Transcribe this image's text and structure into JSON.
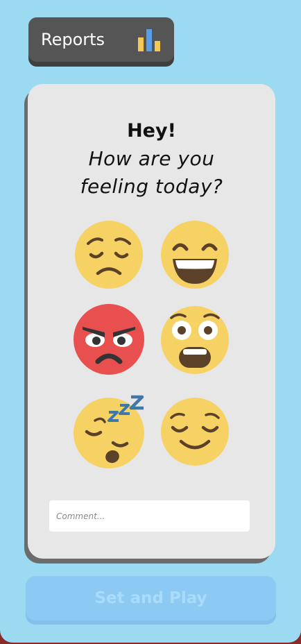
{
  "reports_button": {
    "label": "Reports",
    "icon": "bar-chart-icon"
  },
  "greeting": {
    "title": "Hey!",
    "question": "How are you\nfeeling today?"
  },
  "moods": [
    {
      "name": "sad",
      "icon": "sad-face-icon"
    },
    {
      "name": "happy",
      "icon": "grinning-face-icon"
    },
    {
      "name": "angry",
      "icon": "angry-face-icon"
    },
    {
      "name": "shocked",
      "icon": "shocked-face-icon"
    },
    {
      "name": "sleepy",
      "icon": "sleepy-face-icon"
    },
    {
      "name": "calm",
      "icon": "relieved-face-icon"
    }
  ],
  "comment": {
    "placeholder": "Comment...",
    "value": ""
  },
  "action_button": {
    "label": "Set and Play",
    "enabled": false
  },
  "colors": {
    "background": "#9bdaf1",
    "card": "#e7e7e7",
    "reports_button": "#555555",
    "emoji_yellow": "#f6d264",
    "emoji_red": "#e84f4f",
    "action_button": "#8ccaf3"
  }
}
